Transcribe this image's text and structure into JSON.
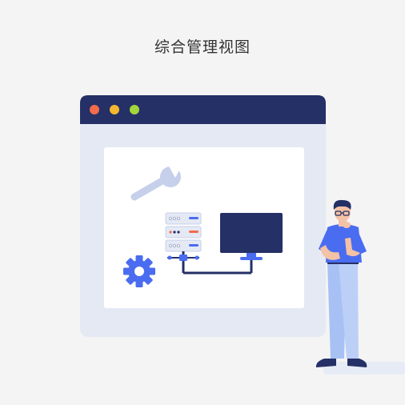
{
  "page": {
    "title": "综合管理视图"
  },
  "illustration": {
    "window_dots": [
      "red-dot",
      "yellow-dot",
      "green-dot"
    ],
    "icons": [
      "wrench-icon",
      "server-rack-icon",
      "monitor-icon",
      "gear-icon",
      "person-thinking-figure"
    ],
    "colors": {
      "background": "#f4f4f4",
      "window_frame": "#e4e9f4",
      "titlebar": "#243066",
      "panel": "#ffffff",
      "accent_blue": "#4a6cf0",
      "dot_red": "#f26b4c",
      "dot_yellow": "#f5b731",
      "dot_green": "#a3d63a"
    }
  }
}
